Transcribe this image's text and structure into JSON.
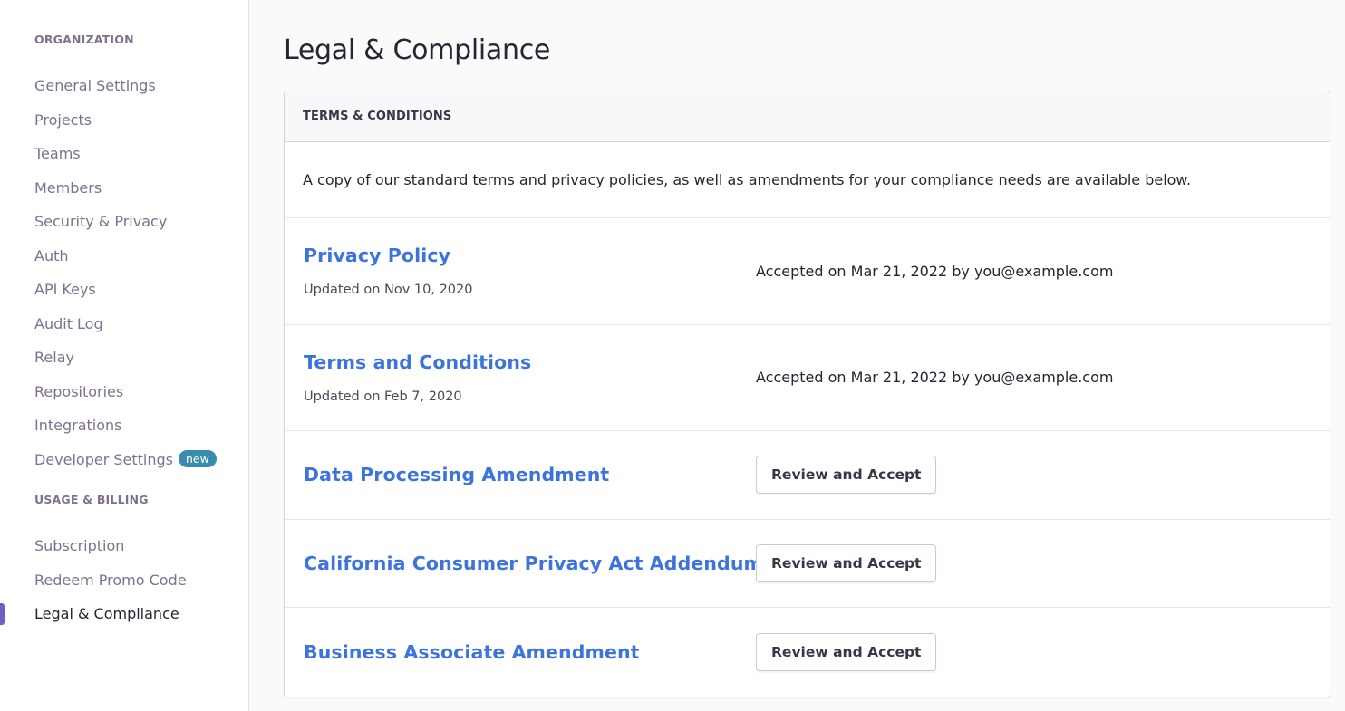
{
  "sidebar": {
    "org_heading": "ORGANIZATION",
    "org_items": [
      {
        "label": "General Settings"
      },
      {
        "label": "Projects"
      },
      {
        "label": "Teams"
      },
      {
        "label": "Members"
      },
      {
        "label": "Security & Privacy"
      },
      {
        "label": "Auth"
      },
      {
        "label": "API Keys"
      },
      {
        "label": "Audit Log"
      },
      {
        "label": "Relay"
      },
      {
        "label": "Repositories"
      },
      {
        "label": "Integrations"
      },
      {
        "label": "Developer Settings",
        "badge": "new"
      }
    ],
    "billing_heading": "USAGE & BILLING",
    "billing_items": [
      {
        "label": "Subscription"
      },
      {
        "label": "Redeem Promo Code"
      },
      {
        "label": "Legal & Compliance",
        "active": true
      }
    ]
  },
  "main": {
    "title": "Legal & Compliance",
    "panel": {
      "header": "TERMS & CONDITIONS",
      "intro": "A copy of our standard terms and privacy policies, as well as amendments for your compliance needs are available below.",
      "documents": [
        {
          "title": "Privacy Policy",
          "updated": "Updated on Nov 10, 2020",
          "status": "Accepted on Mar 21, 2022 by you@example.com"
        },
        {
          "title": "Terms and Conditions",
          "updated": "Updated on Feb 7, 2020",
          "status": "Accepted on Mar 21, 2022 by you@example.com"
        },
        {
          "title": "Data Processing Amendment",
          "action": "Review and Accept"
        },
        {
          "title": "California Consumer Privacy Act Addendum",
          "action": "Review and Accept"
        },
        {
          "title": "Business Associate Amendment",
          "action": "Review and Accept"
        }
      ]
    }
  },
  "colors": {
    "accent": "#6c5fc7",
    "link": "#3d74db",
    "badge": "#3a8caf",
    "muted_text": "#80708f"
  }
}
